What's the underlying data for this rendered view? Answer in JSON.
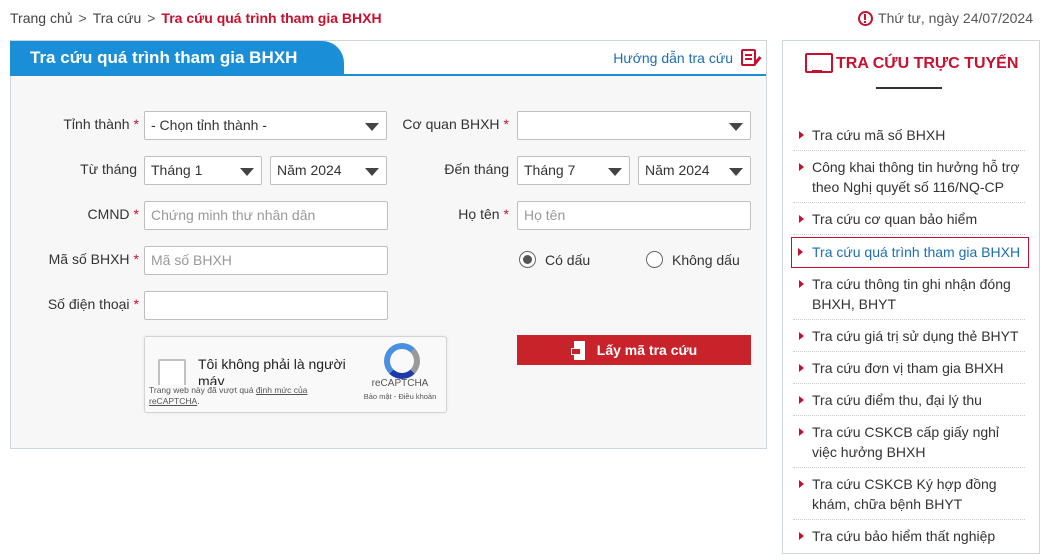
{
  "breadcrumb": {
    "home": "Trang chủ",
    "sep1": ">",
    "section": "Tra cứu",
    "sep2": ">",
    "current": "Tra cứu quá trình tham gia BHXH"
  },
  "date_text": "Thứ tư, ngày 24/07/2024",
  "form": {
    "title": "Tra cứu quá trình tham gia BHXH",
    "guide_label": "Hướng dẫn tra cứu",
    "required_mark": "*",
    "province_label": "Tỉnh thành",
    "province_value": "- Chọn tỉnh thành -",
    "agency_label": "Cơ quan BHXH",
    "agency_value": "",
    "from_label": "Từ tháng",
    "from_month": "Tháng 1",
    "from_year": "Năm 2024",
    "to_label": "Đến tháng",
    "to_month": "Tháng 7",
    "to_year": "Năm 2024",
    "id_label": "CMND",
    "id_placeholder": "Chứng minh thư nhân dân",
    "name_label": "Họ tên",
    "name_placeholder": "Họ tên",
    "bhxh_label": "Mã số BHXH",
    "bhxh_placeholder": "Mã số BHXH",
    "phone_label": "Số điện thoại",
    "phone_value": "",
    "radio_accent": "Có dấu",
    "radio_no_accent": "Không dấu",
    "radio_selected": "Có dấu",
    "submit_label": "Lấy mã tra cứu"
  },
  "captcha": {
    "text": "Tôi không phải là người máy",
    "note": "Trang web này đã vượt quá",
    "note_link": "định mức của reCAPTCHA",
    "brand": "reCAPTCHA",
    "links": "Bảo mật - Điều khoản"
  },
  "sidebar": {
    "title": "TRA CỨU TRỰC TUYẾN",
    "items": [
      {
        "label": "Tra cứu mã số BHXH"
      },
      {
        "label": "Công khai thông tin hưởng hỗ trợ theo Nghị quyết số 116/NQ-CP"
      },
      {
        "label": "Tra cứu cơ quan bảo hiểm"
      },
      {
        "label": "Tra cứu quá trình tham gia BHXH"
      },
      {
        "label": "Tra cứu thông tin ghi nhận đóng BHXH, BHYT"
      },
      {
        "label": "Tra cứu giá trị sử dụng thẻ BHYT"
      },
      {
        "label": "Tra cứu đơn vị tham gia BHXH"
      },
      {
        "label": "Tra cứu điểm thu, đại lý thu"
      },
      {
        "label": "Tra cứu CSKCB cấp giấy nghỉ việc hưởng BHXH"
      },
      {
        "label": "Tra cứu CSKCB Ký hợp đồng khám, chữa bệnh BHYT"
      },
      {
        "label": "Tra cứu bảo hiểm thất nghiệp"
      }
    ],
    "active_index": 3
  },
  "colors": {
    "brand_red": "#c8102e",
    "brand_blue": "#1a8fd8",
    "link_blue": "#1a6fb5"
  }
}
